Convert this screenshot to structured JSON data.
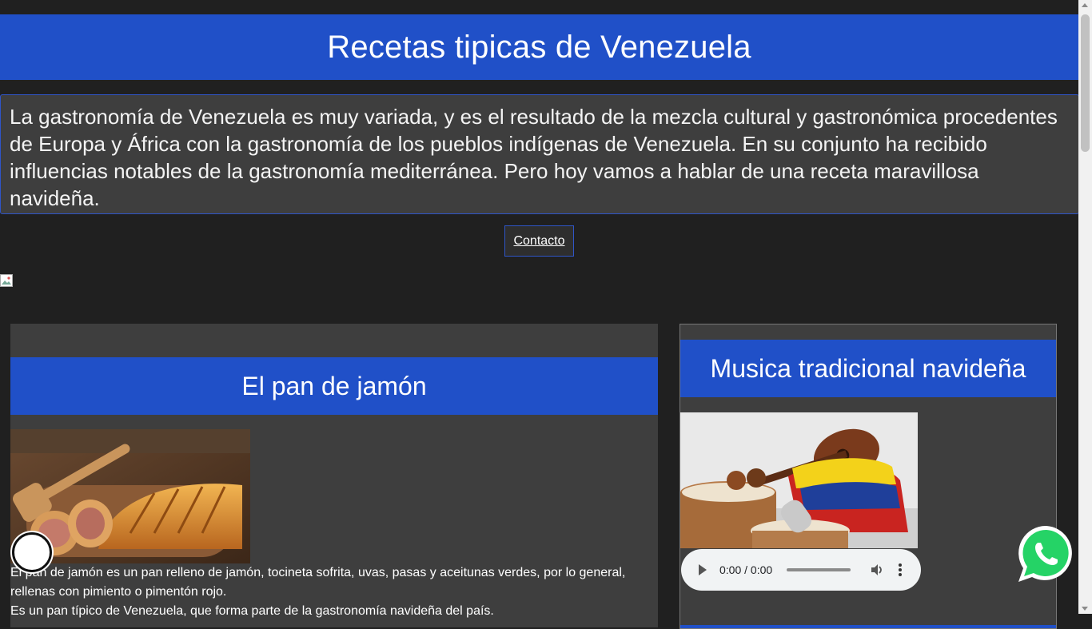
{
  "header": {
    "title": "Recetas tipicas de Venezuela"
  },
  "intro": {
    "text": "La gastronomía de Venezuela es muy variada, y es el resultado de la mezcla cultural y gastronómica procedentes de Europa y África con la gastronomía de los pueblos indígenas de Venezuela. En su conjunto ha recibido influencias notables de la gastronomía mediterránea. Pero hoy vamos a hablar de una receta maravillosa navideña."
  },
  "contact": {
    "label": "Contacto"
  },
  "recipe_card": {
    "title": "El pan de jamón",
    "paragraph1": "El pan de jamón es un pan relleno de jamón, tocineta sofrita, uvas, pasas y aceitunas verdes, por lo general, rellenas con pimiento o pimentón rojo.",
    "paragraph2": "Es un pan típico de Venezuela, que forma parte de la gastronomía navideña del país."
  },
  "music_card": {
    "title": "Musica tradicional navideña",
    "audio": {
      "time": "0:00 / 0:00"
    }
  },
  "colors": {
    "accent": "#2050c8",
    "background": "#202020",
    "card": "#3e3e3e",
    "whatsapp": "#25d366"
  },
  "icons": {
    "play": "play-icon",
    "volume": "volume-icon",
    "more": "more-vert-icon",
    "whatsapp": "whatsapp-icon",
    "broken_image": "broken-image-icon"
  }
}
